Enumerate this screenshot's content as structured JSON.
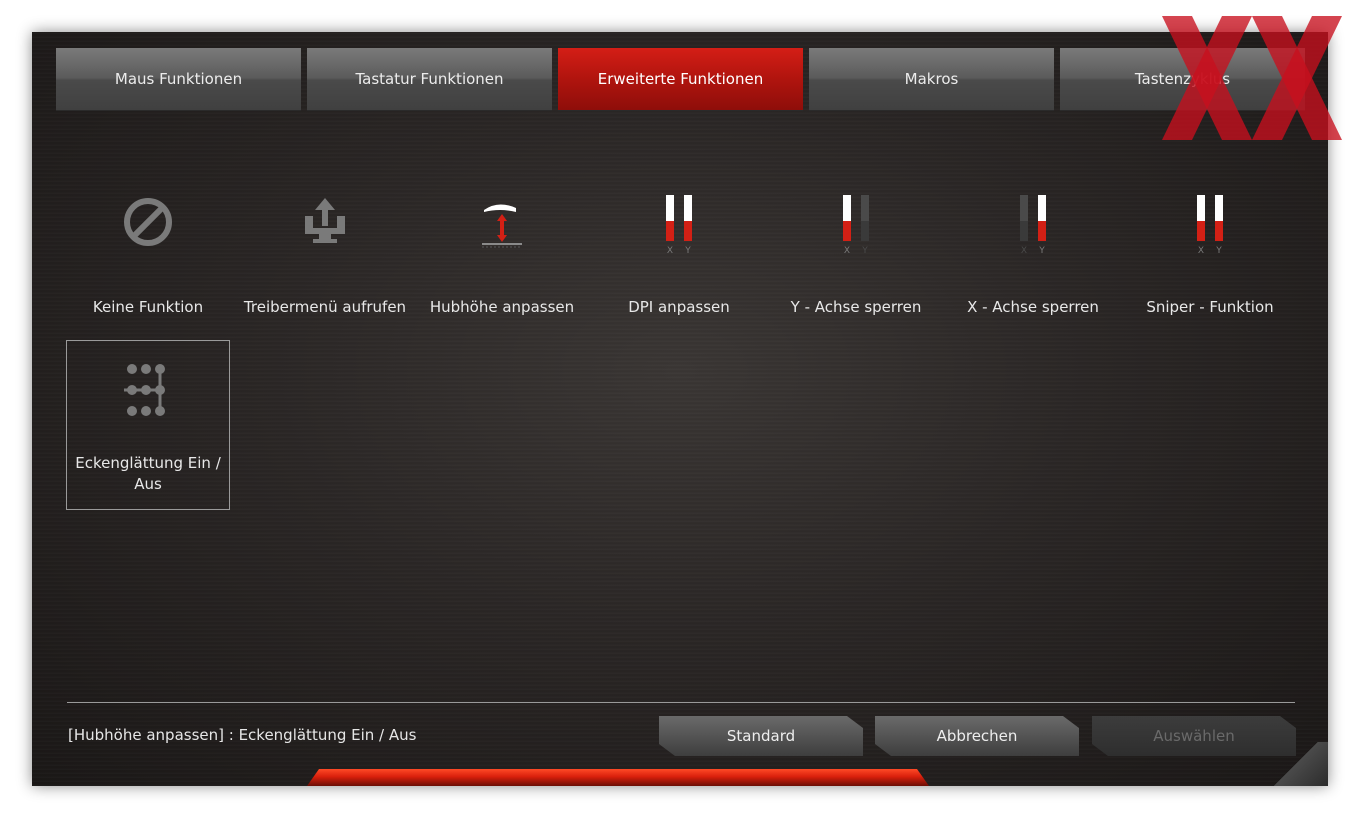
{
  "tabs": [
    {
      "label": "Maus Funktionen",
      "active": false
    },
    {
      "label": "Tastatur Funktionen",
      "active": false
    },
    {
      "label": "Erweiterte Funktionen",
      "active": true
    },
    {
      "label": "Makros",
      "active": false
    },
    {
      "label": "Tastenzyklus",
      "active": false
    }
  ],
  "functions": [
    {
      "label": "Keine Funktion",
      "icon": "no-function-icon"
    },
    {
      "label": "Treibermenü aufrufen",
      "icon": "driver-menu-icon"
    },
    {
      "label": "Hubhöhe anpassen",
      "icon": "lift-height-icon"
    },
    {
      "label": "DPI anpassen",
      "icon": "dpi-adjust-icon"
    },
    {
      "label": "Y - Achse sperren",
      "icon": "lock-y-axis-icon"
    },
    {
      "label": "X - Achse sperren",
      "icon": "lock-x-axis-icon"
    },
    {
      "label": "Sniper - Funktion",
      "icon": "sniper-icon"
    },
    {
      "label": "Eckenglättung Ein / Aus",
      "icon": "angle-snapping-icon",
      "selected": true
    }
  ],
  "axis_labels": {
    "x": "X",
    "y": "Y"
  },
  "status_text": "[Hubhöhe anpassen] : Eckenglättung Ein / Aus",
  "buttons": {
    "standard": "Standard",
    "cancel": "Abbrechen",
    "select": "Auswählen"
  },
  "colors": {
    "accent": "#c41a12",
    "tab": "#5a5a5a",
    "text": "#e8e8e8",
    "watermark": "#c8101e"
  }
}
